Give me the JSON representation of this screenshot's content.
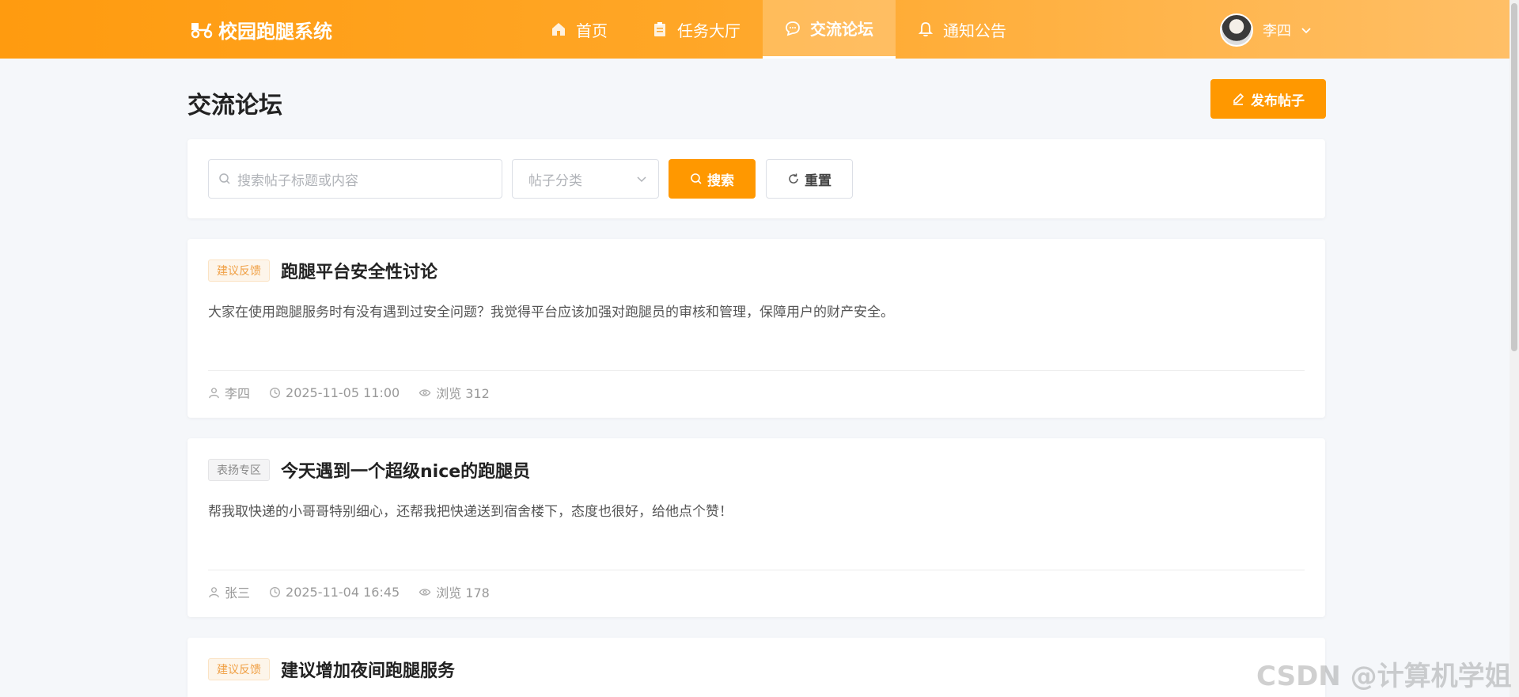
{
  "app": {
    "title": "校园跑腿系统"
  },
  "nav": {
    "items": [
      {
        "label": "首页"
      },
      {
        "label": "任务大厅"
      },
      {
        "label": "交流论坛"
      },
      {
        "label": "通知公告"
      }
    ],
    "active_index": 2
  },
  "user": {
    "name": "李四"
  },
  "page": {
    "title": "交流论坛",
    "publish_label": "发布帖子"
  },
  "search": {
    "placeholder": "搜索帖子标题或内容",
    "category_placeholder": "帖子分类",
    "search_label": "搜索",
    "reset_label": "重置"
  },
  "posts": [
    {
      "tag": "建议反馈",
      "title": "跑腿平台安全性讨论",
      "body": "大家在使用跑腿服务时有没有遇到过安全问题？我觉得平台应该加强对跑腿员的审核和管理，保障用户的财产安全。",
      "author": "李四",
      "time": "2025-11-05 11:00",
      "views": "浏览 312"
    },
    {
      "tag": "表扬专区",
      "title": "今天遇到一个超级nice的跑腿员",
      "body": "帮我取快递的小哥哥特别细心，还帮我把快递送到宿舍楼下，态度也很好，给他点个赞！",
      "author": "张三",
      "time": "2025-11-04 16:45",
      "views": "浏览 178"
    },
    {
      "tag": "建议反馈",
      "title": "建议增加夜间跑腿服务"
    }
  ],
  "watermark": "CSDN @计算机学姐",
  "colors": {
    "accent": "#ff9800",
    "tag_orange": "#f0a045"
  }
}
